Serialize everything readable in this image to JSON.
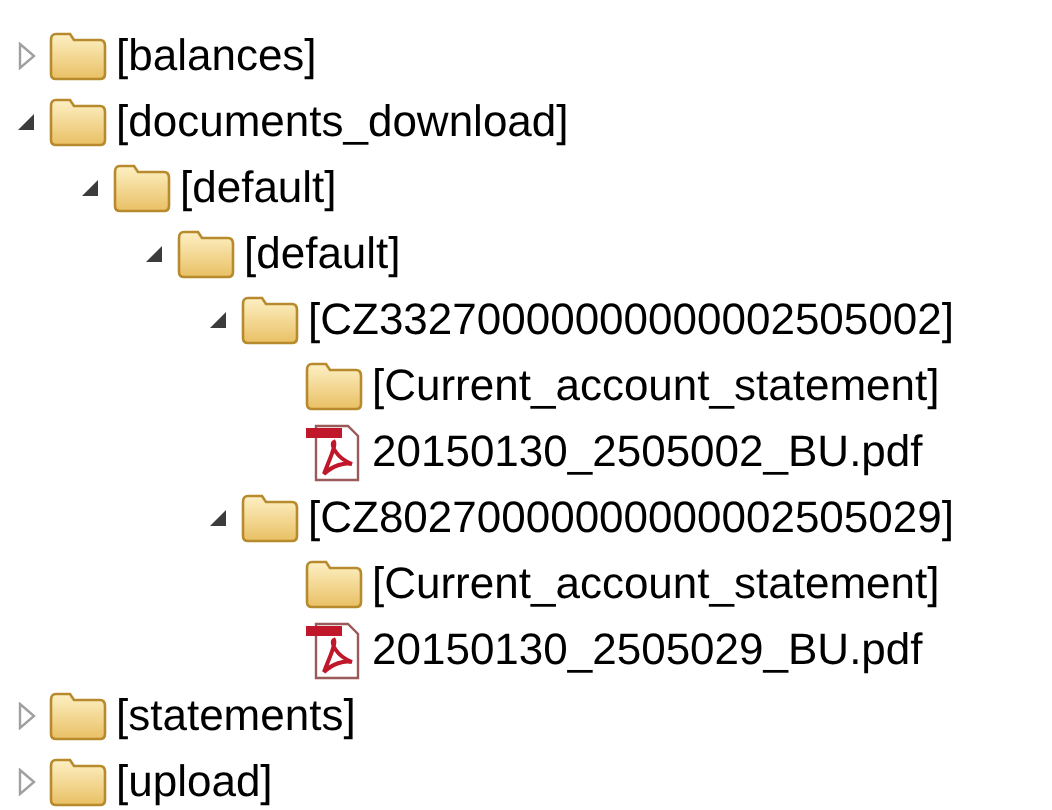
{
  "tree": [
    {
      "kind": "folder",
      "label": "[balances]",
      "expanded": false
    },
    {
      "kind": "folder",
      "label": "[documents_download]",
      "expanded": true,
      "children": [
        {
          "kind": "folder",
          "label": "[default]",
          "expanded": true,
          "children": [
            {
              "kind": "folder",
              "label": "[default]",
              "expanded": true,
              "children": [
                {
                  "kind": "folder",
                  "label": "[CZ33270000000000002505002]",
                  "expanded": true,
                  "children": [
                    {
                      "kind": "folder",
                      "label": "[Current_account_statement]"
                    },
                    {
                      "kind": "file",
                      "label": "20150130_2505002_BU.pdf"
                    }
                  ]
                },
                {
                  "kind": "folder",
                  "label": "[CZ80270000000000002505029]",
                  "expanded": true,
                  "children": [
                    {
                      "kind": "folder",
                      "label": "[Current_account_statement]"
                    },
                    {
                      "kind": "file",
                      "label": "20150130_2505029_BU.pdf"
                    }
                  ]
                }
              ]
            }
          ]
        }
      ]
    },
    {
      "kind": "folder",
      "label": "[statements]",
      "expanded": false
    },
    {
      "kind": "folder",
      "label": "[upload]",
      "expanded": false
    }
  ]
}
